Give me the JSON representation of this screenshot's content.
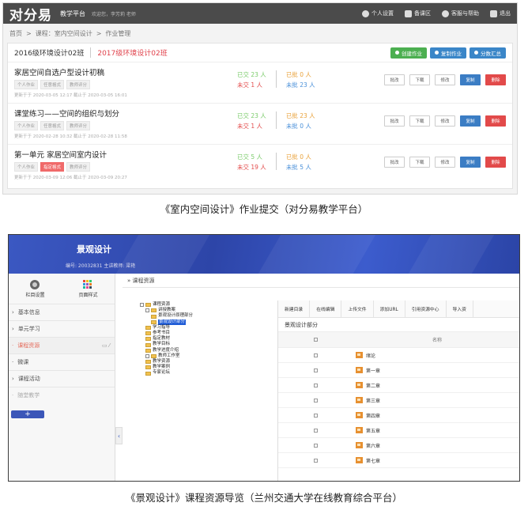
{
  "shot1": {
    "logo": "对分易",
    "platform": "教学平台",
    "greeting": "欢迎您，李芳莉 老师",
    "nav": [
      "个人设置",
      "备课区",
      "客服与帮助",
      "退出"
    ],
    "breadcrumb": [
      "首页",
      ">",
      "课程：室内空间设计",
      ">",
      "作业管理"
    ],
    "class_a": "2016级环境设计02班",
    "class_b": "2017级环境设计02班",
    "actions": [
      "创建作业",
      "复制作业",
      "分数汇总"
    ],
    "assignments": [
      {
        "title": "家居空间自选户型设计初稿",
        "tags": [
          "个人作业",
          "任意格式",
          "教师评分"
        ],
        "meta": "更新于于 2020-03-05 12:17  截止于 2020-03-05 16:01",
        "submitted": "已交 23 人",
        "not_submitted": "未交 1 人",
        "graded": "已批 0 人",
        "ungraded": "未批 23 人"
      },
      {
        "title": "课堂练习——空间的组织与划分",
        "tags": [
          "个人作业",
          "任意格式",
          "教师评分"
        ],
        "meta": "更新于于 2020-02-28 10:32  截止于 2020-02-28 11:58",
        "submitted": "已交 23 人",
        "not_submitted": "未交 1 人",
        "graded": "已批 23 人",
        "ungraded": "未批 0 人"
      },
      {
        "title": "第一单元 家居空间室内设计",
        "tags": [
          "个人作业",
          "指定格式",
          "教师评分"
        ],
        "meta": "更新于于 2020-03-09 12:06  截止于 2020-03-09 20:27",
        "submitted": "已交 5 人",
        "not_submitted": "未交 19 人",
        "graded": "已批 0 人",
        "ungraded": "未批 5 人"
      }
    ],
    "row_ops": [
      "批改",
      "下载",
      "修改",
      "复制",
      "删除"
    ]
  },
  "caption1": "《室内空间设计》作业提交（对分易教学平台）",
  "shot2": {
    "title": "景观设计",
    "subtitle": "编号: 20032831    主讲教师: 梁艳",
    "side_top": [
      "栏目设置",
      "页面样式"
    ],
    "menu": [
      "基本信息",
      "单元学习",
      "课程资源",
      "微课",
      "课程活动",
      "随堂教学"
    ],
    "plus": "+",
    "breadcrumb": "» 课程资源",
    "tree": [
      {
        "label": "课程资源",
        "indent": 0,
        "box": "日"
      },
      {
        "label": "讲授教案",
        "indent": 1,
        "box": "日"
      },
      {
        "label": "景观设计原理部分",
        "indent": 2,
        "box": ""
      },
      {
        "label": "景观设计部分",
        "indent": 2,
        "box": "",
        "selected": true
      },
      {
        "label": "学习指导",
        "indent": 1,
        "box": ""
      },
      {
        "label": "参考书目",
        "indent": 1,
        "box": ""
      },
      {
        "label": "指定教材",
        "indent": 1,
        "box": ""
      },
      {
        "label": "教学目标",
        "indent": 1,
        "box": ""
      },
      {
        "label": "教学进度介绍",
        "indent": 1,
        "box": ""
      },
      {
        "label": "教师工作室",
        "indent": 1,
        "box": "田"
      },
      {
        "label": "教学资源",
        "indent": 1,
        "box": ""
      },
      {
        "label": "教学案例",
        "indent": 1,
        "box": ""
      },
      {
        "label": "专家论坛",
        "indent": 1,
        "box": ""
      }
    ],
    "toolbar": [
      "新建目录",
      "在线编辑",
      "上传文件",
      "添加URL",
      "引用资源中心",
      "导入资"
    ],
    "panel_title": "景观设计部分",
    "col_name": "名称",
    "files": [
      "绪论",
      "第一章",
      "第二章",
      "第三章",
      "第四章",
      "第五章",
      "第六章",
      "第七章"
    ]
  },
  "caption2": "《景观设计》课程资源导览（兰州交通大学在线教育综合平台）",
  "colors": {
    "accent_red": "#e0404a",
    "green": "#4caf50",
    "blue": "#3a86c8",
    "banner": "#2d45a8"
  }
}
